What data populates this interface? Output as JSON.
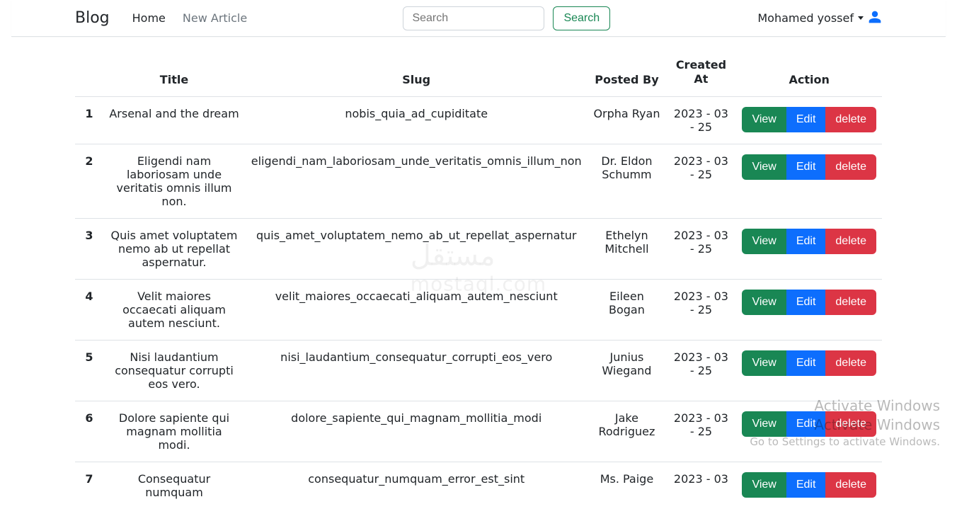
{
  "nav": {
    "brand": "Blog",
    "home": "Home",
    "new_article": "New Article",
    "search_placeholder": "Search",
    "search_button": "Search",
    "username": "Mohamed yossef"
  },
  "table": {
    "headers": {
      "title": "Title",
      "slug": "Slug",
      "posted_by": "Posted By",
      "created_at_l1": "Created",
      "created_at_l2": "At",
      "action": "Action"
    },
    "action_labels": {
      "view": "View",
      "edit": "Edit",
      "delete": "delete"
    },
    "rows": [
      {
        "idx": "1",
        "title": "Arsenal and the dream",
        "slug": "nobis_quia_ad_cupiditate",
        "posted_by": "Orpha Ryan",
        "created_at": "2023 - 03 - 25"
      },
      {
        "idx": "2",
        "title": "Eligendi nam laboriosam unde veritatis omnis illum non.",
        "slug": "eligendi_nam_laboriosam_unde_veritatis_omnis_illum_non",
        "posted_by": "Dr. Eldon Schumm",
        "created_at": "2023 - 03 - 25"
      },
      {
        "idx": "3",
        "title": "Quis amet voluptatem nemo ab ut repellat aspernatur.",
        "slug": "quis_amet_voluptatem_nemo_ab_ut_repellat_aspernatur",
        "posted_by": "Ethelyn Mitchell",
        "created_at": "2023 - 03 - 25"
      },
      {
        "idx": "4",
        "title": "Velit maiores occaecati aliquam autem nesciunt.",
        "slug": "velit_maiores_occaecati_aliquam_autem_nesciunt",
        "posted_by": "Eileen Bogan",
        "created_at": "2023 - 03 - 25"
      },
      {
        "idx": "5",
        "title": "Nisi laudantium consequatur corrupti eos vero.",
        "slug": "nisi_laudantium_consequatur_corrupti_eos_vero",
        "posted_by": "Junius Wiegand",
        "created_at": "2023 - 03 - 25"
      },
      {
        "idx": "6",
        "title": "Dolore sapiente qui magnam mollitia modi.",
        "slug": "dolore_sapiente_qui_magnam_mollitia_modi",
        "posted_by": "Jake Rodriguez",
        "created_at": "2023 - 03 - 25"
      },
      {
        "idx": "7",
        "title": "Consequatur numquam",
        "slug": "consequatur_numquam_error_est_sint",
        "posted_by": "Ms. Paige",
        "created_at": "2023 - 03"
      }
    ]
  },
  "watermark": {
    "line1": "مستقل",
    "line2": "mostaql.com"
  },
  "activate": {
    "t1a": "Activate Windows",
    "t1b": "Activate Windows",
    "t2": "Go to Settings to activate Windows."
  }
}
